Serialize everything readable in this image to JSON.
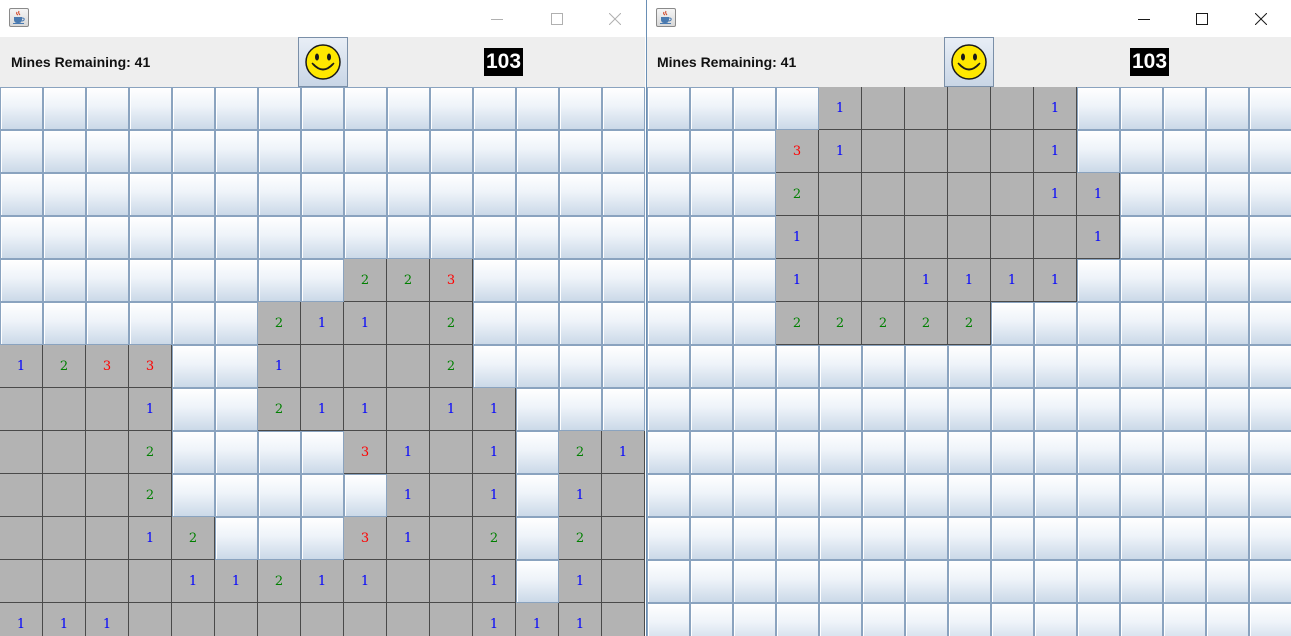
{
  "colors": {
    "n1": "#0000ff",
    "n2": "#008000",
    "n3": "#ff0000",
    "revealed": "#b3b3b3",
    "toolbar": "#eeeeee",
    "timer_bg": "#000000"
  },
  "icons": {
    "app": "java-coffee-icon",
    "status": "smiley-face-icon",
    "minimize": "minimize-icon",
    "maximize": "maximize-icon",
    "close": "close-icon"
  },
  "windows": [
    {
      "mines_label": "Mines Remaining: 41",
      "timer": "103",
      "board": [
        "###############",
        "###############",
        "###############",
        "###############",
        "########223####",
        "######211.2####",
        "1233##1...2####",
        "...1##211.11###",
        "...2####31.1#21",
        "...2#####1.1#1.",
        "...12###31.2#2.",
        "....11211..1#1.",
        "111........111."
      ]
    },
    {
      "mines_label": "Mines Remaining: 41",
      "timer": "103",
      "board": [
        "####1....1#####",
        "###31....1#####",
        "###2.....11####",
        "###1......1####",
        "###1..1111#####",
        "###22222#######",
        "###############",
        "###############",
        "###############",
        "###############",
        "###############",
        "###############",
        "###############"
      ]
    }
  ]
}
